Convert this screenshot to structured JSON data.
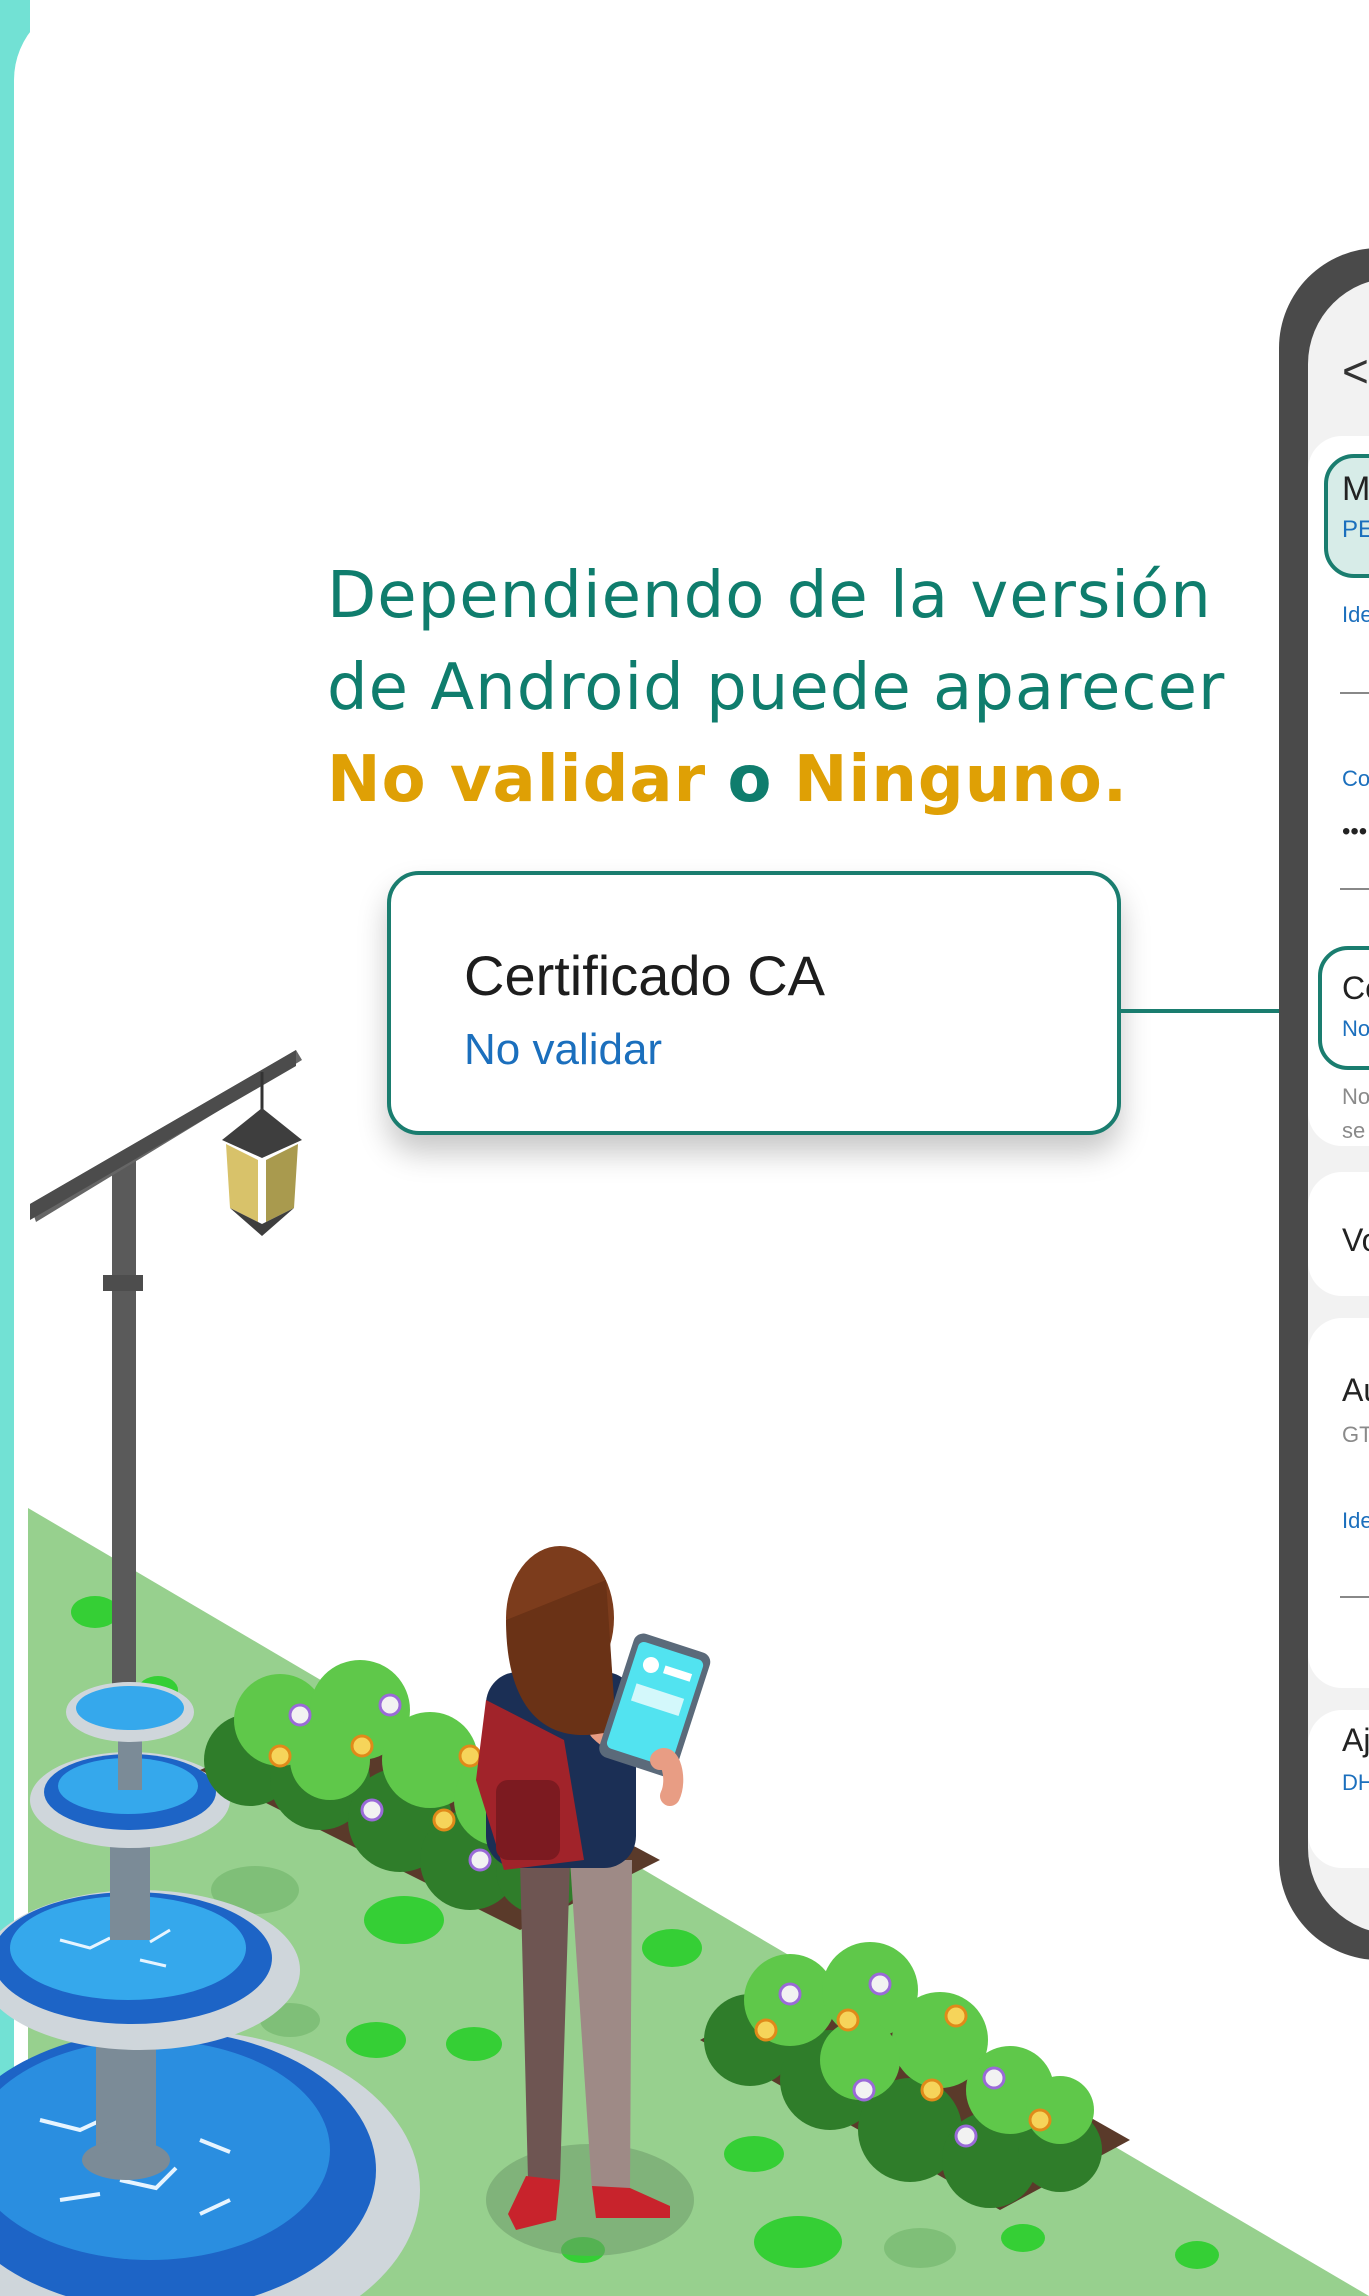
{
  "headline": {
    "line1": "Dependiendo de la versión",
    "line2": "de Android puede aparecer",
    "option_a": "No validar",
    "connector": "o",
    "option_b": "Ninguno."
  },
  "callout": {
    "title": "Certificado CA",
    "value": "No validar"
  },
  "phone": {
    "back": "<",
    "rows": {
      "r1_title": "M",
      "r1_sub": "PE",
      "r2": "Ide",
      "r3_label": "Co",
      "r3_dots": "•••",
      "r4_title": "Ce",
      "r4_sub": "No",
      "r5_a": "No",
      "r5_b": "se",
      "r6": "Vo",
      "r7_title": "Au",
      "r7_sub": "GT",
      "r8": "Ide",
      "r9_title": "Aj",
      "r9_sub": "DH"
    }
  },
  "colors": {
    "teal": "#0f7d6d",
    "gold": "#dfa005",
    "link_blue": "#1b6fbd",
    "frame_aqua": "#72e1d4"
  }
}
